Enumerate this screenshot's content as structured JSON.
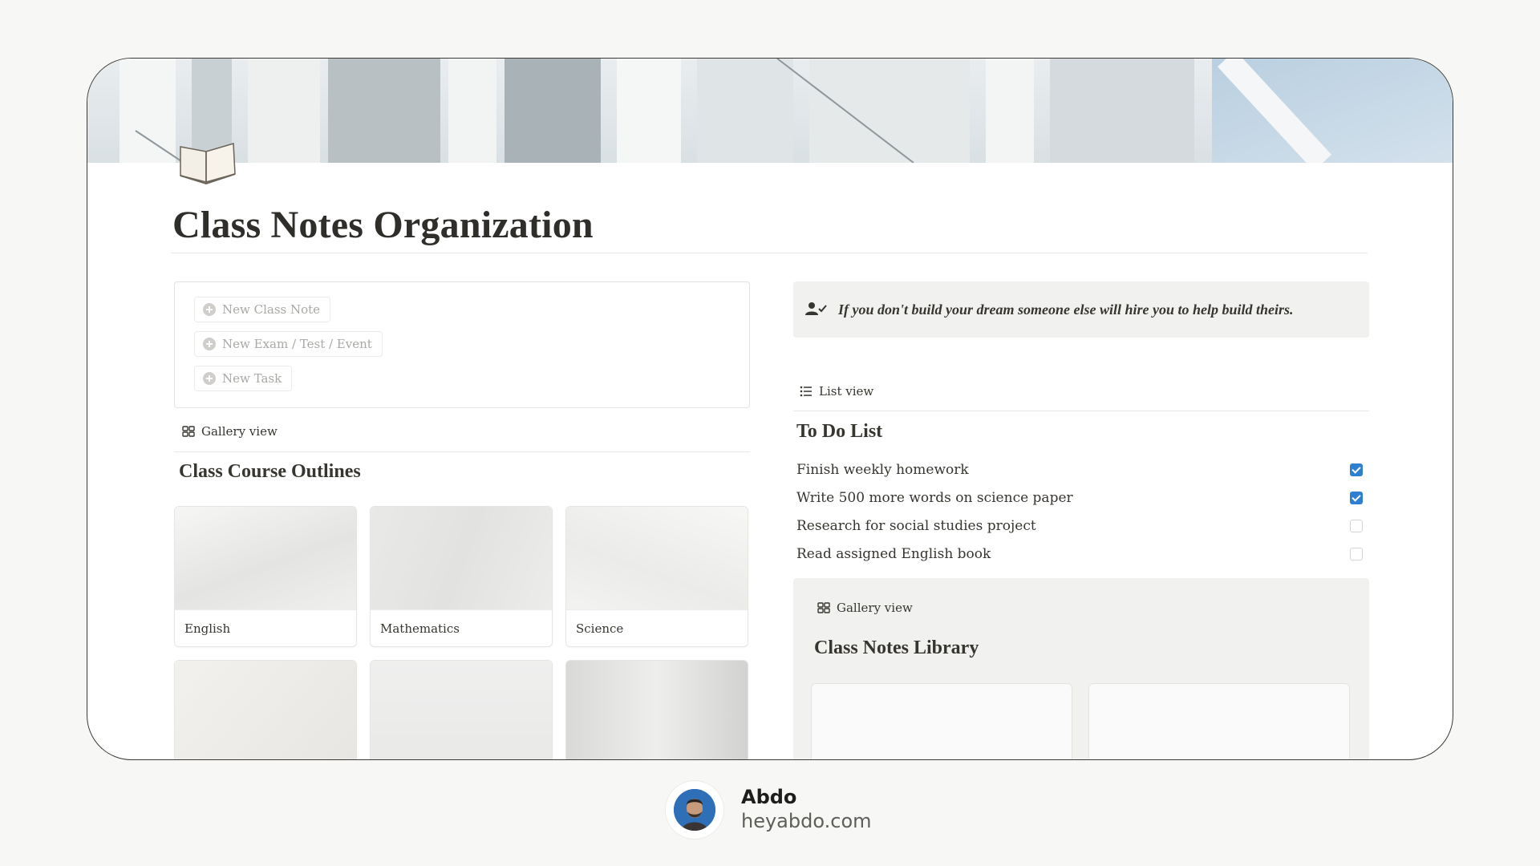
{
  "page": {
    "title": "Class Notes Organization"
  },
  "template_buttons": [
    {
      "label": "New Class Note"
    },
    {
      "label": "New Exam / Test / Event"
    },
    {
      "label": "New Task"
    }
  ],
  "left": {
    "view_tab": "Gallery view",
    "section_title": "Class Course Outlines",
    "cards": [
      {
        "label": "English"
      },
      {
        "label": "Mathematics"
      },
      {
        "label": "Science"
      },
      {
        "label": ""
      },
      {
        "label": ""
      },
      {
        "label": ""
      }
    ]
  },
  "quote": {
    "text": "If you don't build your dream someone else will hire you to help build theirs.",
    "icon": "user-check-icon"
  },
  "todo": {
    "view_tab": "List view",
    "title": "To Do List",
    "items": [
      {
        "label": "Finish weekly homework",
        "checked": true
      },
      {
        "label": "Write 500 more words on science paper",
        "checked": true
      },
      {
        "label": "Research for social studies project",
        "checked": false
      },
      {
        "label": "Read assigned English book",
        "checked": false
      }
    ]
  },
  "library": {
    "view_tab": "Gallery view",
    "title": "Class Notes Library"
  },
  "footer": {
    "name": "Abdo",
    "site": "heyabdo.com"
  },
  "colors": {
    "background": "#f7f7f5",
    "accent_checkbox": "#2f7fd1",
    "text": "#37352f"
  }
}
